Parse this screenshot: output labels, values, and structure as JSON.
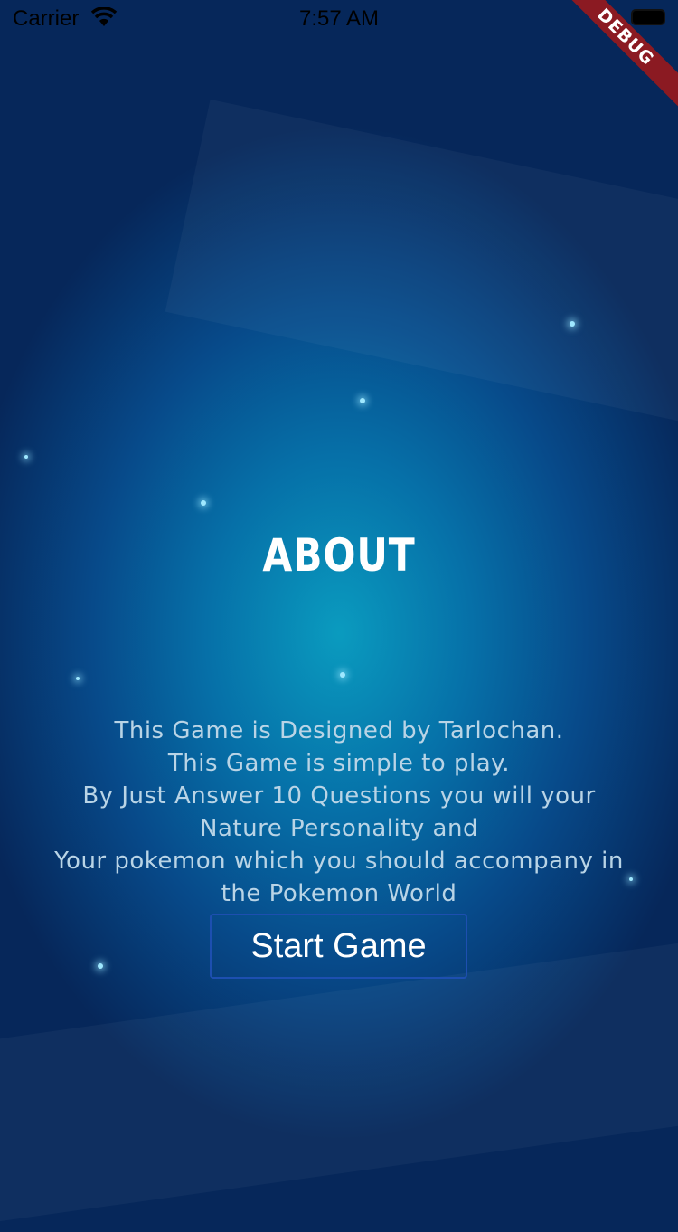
{
  "status_bar": {
    "carrier": "Carrier",
    "time": "7:57 AM"
  },
  "debug_banner": "DEBUG",
  "title": "ABOUT",
  "about_lines": [
    "This Game is Designed by Tarlochan.",
    "This Game is simple to play.",
    "By Just Answer 10 Questions you will your",
    "Nature Personality and",
    "Your pokemon which you should accompany in",
    "the Pokemon World"
  ],
  "start_button": "Start Game",
  "colors": {
    "button_border": "#1d4fb0",
    "banner": "#8b1a22"
  }
}
